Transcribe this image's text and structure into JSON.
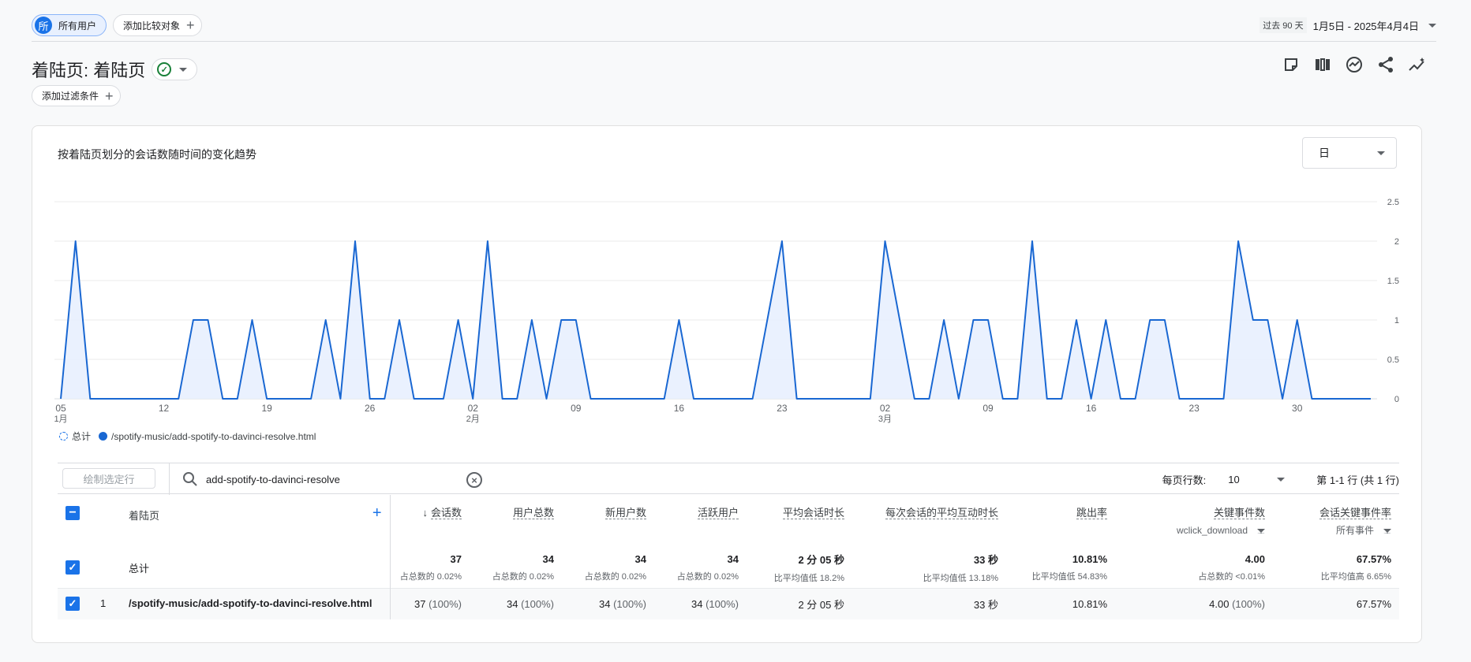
{
  "topbar": {
    "all_users_avatar": "所",
    "all_users_label": "所有用户",
    "add_compare_label": "添加比较对象",
    "date_past": "过去 90 天",
    "date_range": "1月5日 - 2025年4月4日"
  },
  "page": {
    "title": "着陆页: 着陆页",
    "add_filter_label": "添加过滤条件"
  },
  "toolbar_icons": [
    "note-icon",
    "compare-columns-icon",
    "insights-chart-icon",
    "share-icon",
    "auto-insights-icon"
  ],
  "card": {
    "title": "按着陆页划分的会话数随时间的变化趋势",
    "granularity": "日"
  },
  "chart_data": {
    "type": "area",
    "x_start": "2025-01-05",
    "x_end": "2025-04-04",
    "x_ticks": [
      {
        "day": "05",
        "month": "1月"
      },
      {
        "day": "12",
        "month": ""
      },
      {
        "day": "19",
        "month": ""
      },
      {
        "day": "26",
        "month": ""
      },
      {
        "day": "02",
        "month": "2月"
      },
      {
        "day": "09",
        "month": ""
      },
      {
        "day": "16",
        "month": ""
      },
      {
        "day": "23",
        "month": ""
      },
      {
        "day": "02",
        "month": "3月"
      },
      {
        "day": "09",
        "month": ""
      },
      {
        "day": "16",
        "month": ""
      },
      {
        "day": "23",
        "month": ""
      },
      {
        "day": "30",
        "month": ""
      }
    ],
    "y_ticks": [
      "2.5",
      "2",
      "1.5",
      "1",
      "0.5",
      "0"
    ],
    "ylim": [
      0,
      2.5
    ],
    "y_axis_position": "right",
    "grid": true,
    "series": [
      {
        "name": "/spotify-music/add-spotify-to-davinci-resolve.html",
        "color": "#1967d2",
        "values": [
          0,
          2,
          0,
          0,
          0,
          0,
          0,
          0,
          0,
          1,
          1,
          0,
          0,
          1,
          0,
          0,
          0,
          0,
          1,
          0,
          2,
          0,
          0,
          1,
          0,
          0,
          0,
          1,
          0,
          2,
          0,
          0,
          1,
          0,
          1,
          1,
          0,
          0,
          0,
          0,
          0,
          0,
          1,
          0,
          0,
          0,
          0,
          0,
          1,
          2,
          0,
          0,
          0,
          0,
          0,
          0,
          2,
          1,
          0,
          0,
          1,
          0,
          1,
          1,
          0,
          0,
          2,
          0,
          0,
          1,
          0,
          1,
          0,
          0,
          1,
          1,
          0,
          0,
          0,
          0,
          2,
          1,
          1,
          0,
          1,
          0,
          0,
          0,
          0,
          0
        ]
      }
    ],
    "legend": [
      "总计",
      "/spotify-music/add-spotify-to-davinci-resolve.html"
    ]
  },
  "table": {
    "plot_rows_label": "绘制选定行",
    "search_value": "add-spotify-to-davinci-resolve",
    "rows_per_page_label": "每页行数:",
    "rows_per_page_value": "10",
    "pager": "第 1-1 行 (共 1 行)",
    "dim_header": "着陆页",
    "headers": [
      {
        "label": "会话数",
        "sorted": true
      },
      {
        "label": "用户总数"
      },
      {
        "label": "新用户数"
      },
      {
        "label": "活跃用户"
      },
      {
        "label": "平均会话时长"
      },
      {
        "label": "每次会话的平均互动时长"
      },
      {
        "label": "跳出率"
      },
      {
        "label": "关键事件数",
        "sub": "wclick_download"
      },
      {
        "label": "会话关键事件率",
        "sub": "所有事件"
      }
    ],
    "total_label": "总计",
    "totals": [
      {
        "value": "37",
        "note": "占总数的 0.02%"
      },
      {
        "value": "34",
        "note": "占总数的 0.02%"
      },
      {
        "value": "34",
        "note": "占总数的 0.02%"
      },
      {
        "value": "34",
        "note": "占总数的 0.02%"
      },
      {
        "value": "2 分 05 秒",
        "note": "比平均值低 18.2%"
      },
      {
        "value": "33 秒",
        "note": "比平均值低 13.18%"
      },
      {
        "value": "10.81%",
        "note": "比平均值低 54.83%"
      },
      {
        "value": "4.00",
        "note": "占总数的 <0.01%"
      },
      {
        "value": "67.57%",
        "note": "比平均值高 6.65%"
      }
    ],
    "rows": [
      {
        "index": "1",
        "page": "/spotify-music/add-spotify-to-davinci-resolve.html",
        "cells": [
          {
            "v": "37",
            "p": "(100%)"
          },
          {
            "v": "34",
            "p": "(100%)"
          },
          {
            "v": "34",
            "p": "(100%)"
          },
          {
            "v": "34",
            "p": "(100%)"
          },
          {
            "v": "2 分 05 秒",
            "p": ""
          },
          {
            "v": "33 秒",
            "p": ""
          },
          {
            "v": "10.81%",
            "p": ""
          },
          {
            "v": "4.00",
            "p": "(100%)"
          },
          {
            "v": "67.57%",
            "p": ""
          }
        ]
      }
    ]
  }
}
